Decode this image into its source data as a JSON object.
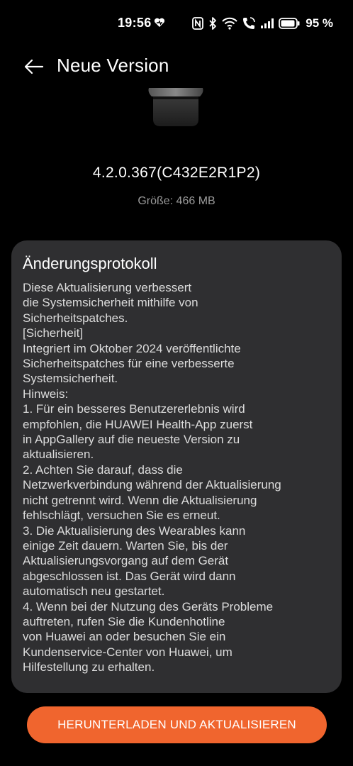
{
  "status_bar": {
    "time": "19:56",
    "battery_percent": "95 %",
    "battery_level": 0.95,
    "icons": [
      "heart-sync-icon",
      "nfc-icon",
      "bluetooth-icon",
      "wifi-icon",
      "wifi-call-icon",
      "signal-icon",
      "battery-icon"
    ]
  },
  "header": {
    "title": "Neue Version"
  },
  "update": {
    "version": "4.2.0.367(C432E2R1P2)",
    "size": "Größe: 466 MB"
  },
  "changelog": {
    "title": "Änderungsprotokoll",
    "lines": [
      "Diese Aktualisierung verbessert",
      "die Systemsicherheit mithilfe von",
      "Sicherheitspatches.",
      "[Sicherheit]",
      "Integriert im Oktober 2024 veröffentlichte",
      "Sicherheitspatches für eine verbesserte",
      "Systemsicherheit.",
      "Hinweis:",
      "1. Für ein besseres Benutzererlebnis wird",
      "empfohlen, die HUAWEI Health-App zuerst",
      "in AppGallery auf die neueste Version zu",
      "aktualisieren.",
      "2. Achten Sie darauf, dass die",
      "Netzwerkverbindung während der Aktualisierung",
      "nicht getrennt wird. Wenn die Aktualisierung",
      "fehlschlägt, versuchen Sie es erneut.",
      "3. Die Aktualisierung des Wearables kann",
      "einige Zeit dauern. Warten Sie, bis der",
      "Aktualisierungsvorgang auf dem Gerät",
      "abgeschlossen ist. Das Gerät wird dann",
      "automatisch neu gestartet.",
      "4. Wenn bei der Nutzung des Geräts Probleme",
      "auftreten, rufen Sie die Kundenhotline",
      "von Huawei an oder besuchen Sie ein",
      "Kundenservice-Center von Huawei, um",
      "Hilfestellung zu erhalten."
    ]
  },
  "actions": {
    "download_label": "HERUNTERLADEN UND AKTUALISIEREN"
  },
  "colors": {
    "background": "#000000",
    "card": "#2f2f31",
    "accent": "#f0652e",
    "secondary_text": "#9a9a9a"
  }
}
